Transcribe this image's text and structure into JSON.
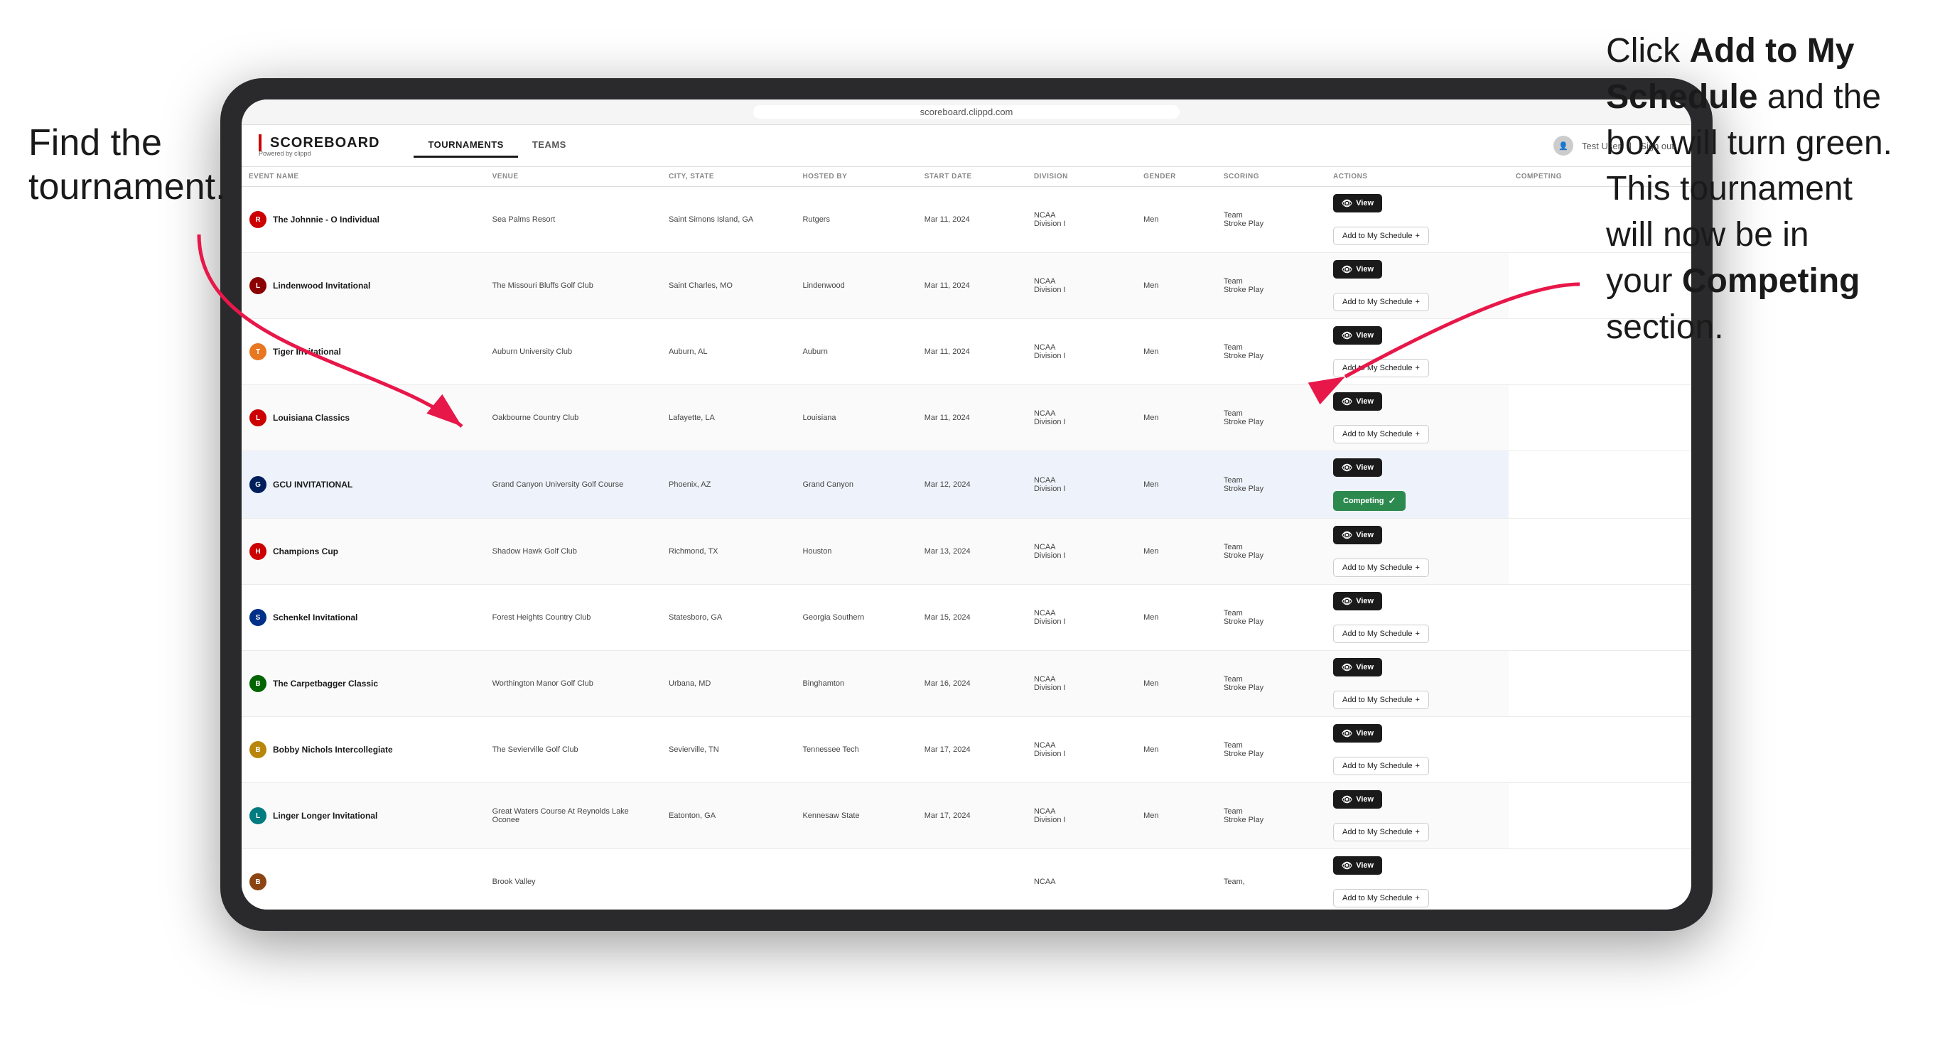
{
  "annotations": {
    "left_text_line1": "Find the",
    "left_text_line2": "tournament.",
    "right_text": "Click Add to My Schedule and the box will turn green. This tournament will now be in your Competing section.",
    "right_text_bold1": "Add to My Schedule",
    "right_text_bold2": "Competing"
  },
  "app": {
    "logo": "SCOREBOARD",
    "logo_sub": "Powered by clippd",
    "nav_tabs": [
      "TOURNAMENTS",
      "TEAMS"
    ],
    "active_tab": "TOURNAMENTS",
    "user_label": "Test User",
    "sign_out": "Sign out"
  },
  "table": {
    "columns": [
      "EVENT NAME",
      "VENUE",
      "CITY, STATE",
      "HOSTED BY",
      "START DATE",
      "DIVISION",
      "GENDER",
      "SCORING",
      "ACTIONS",
      "COMPETING"
    ],
    "rows": [
      {
        "id": 1,
        "logo_color": "logo-red",
        "logo_letter": "R",
        "event_name": "The Johnnie - O Individual",
        "venue": "Sea Palms Resort",
        "city_state": "Saint Simons Island, GA",
        "hosted_by": "Rutgers",
        "start_date": "Mar 11, 2024",
        "division": "NCAA Division I",
        "gender": "Men",
        "scoring": "Team, Stroke Play",
        "action": "View",
        "competing_status": "add",
        "competing_label": "Add to My Schedule +"
      },
      {
        "id": 2,
        "logo_color": "logo-maroon",
        "logo_letter": "L",
        "event_name": "Lindenwood Invitational",
        "venue": "The Missouri Bluffs Golf Club",
        "city_state": "Saint Charles, MO",
        "hosted_by": "Lindenwood",
        "start_date": "Mar 11, 2024",
        "division": "NCAA Division I",
        "gender": "Men",
        "scoring": "Team, Stroke Play",
        "action": "View",
        "competing_status": "add",
        "competing_label": "Add to My Schedule +"
      },
      {
        "id": 3,
        "logo_color": "logo-orange",
        "logo_letter": "T",
        "event_name": "Tiger Invitational",
        "venue": "Auburn University Club",
        "city_state": "Auburn, AL",
        "hosted_by": "Auburn",
        "start_date": "Mar 11, 2024",
        "division": "NCAA Division I",
        "gender": "Men",
        "scoring": "Team, Stroke Play",
        "action": "View",
        "competing_status": "add",
        "competing_label": "Add to My Schedule +"
      },
      {
        "id": 4,
        "logo_color": "logo-red",
        "logo_letter": "L",
        "event_name": "Louisiana Classics",
        "venue": "Oakbourne Country Club",
        "city_state": "Lafayette, LA",
        "hosted_by": "Louisiana",
        "start_date": "Mar 11, 2024",
        "division": "NCAA Division I",
        "gender": "Men",
        "scoring": "Team, Stroke Play",
        "action": "View",
        "competing_status": "add",
        "competing_label": "Add to My Schedule +"
      },
      {
        "id": 5,
        "logo_color": "logo-navy",
        "logo_letter": "G",
        "event_name": "GCU INVITATIONAL",
        "venue": "Grand Canyon University Golf Course",
        "city_state": "Phoenix, AZ",
        "hosted_by": "Grand Canyon",
        "start_date": "Mar 12, 2024",
        "division": "NCAA Division I",
        "gender": "Men",
        "scoring": "Team, Stroke Play",
        "action": "View",
        "competing_status": "competing",
        "competing_label": "Competing ✓",
        "highlighted": true
      },
      {
        "id": 6,
        "logo_color": "logo-red",
        "logo_letter": "H",
        "event_name": "Champions Cup",
        "venue": "Shadow Hawk Golf Club",
        "city_state": "Richmond, TX",
        "hosted_by": "Houston",
        "start_date": "Mar 13, 2024",
        "division": "NCAA Division I",
        "gender": "Men",
        "scoring": "Team, Stroke Play",
        "action": "View",
        "competing_status": "add",
        "competing_label": "Add to My Schedule +"
      },
      {
        "id": 7,
        "logo_color": "logo-blue",
        "logo_letter": "S",
        "event_name": "Schenkel Invitational",
        "venue": "Forest Heights Country Club",
        "city_state": "Statesboro, GA",
        "hosted_by": "Georgia Southern",
        "start_date": "Mar 15, 2024",
        "division": "NCAA Division I",
        "gender": "Men",
        "scoring": "Team, Stroke Play",
        "action": "View",
        "competing_status": "add",
        "competing_label": "Add to My Schedule +"
      },
      {
        "id": 8,
        "logo_color": "logo-green",
        "logo_letter": "B",
        "event_name": "The Carpetbagger Classic",
        "venue": "Worthington Manor Golf Club",
        "city_state": "Urbana, MD",
        "hosted_by": "Binghamton",
        "start_date": "Mar 16, 2024",
        "division": "NCAA Division I",
        "gender": "Men",
        "scoring": "Team, Stroke Play",
        "action": "View",
        "competing_status": "add",
        "competing_label": "Add to My Schedule +"
      },
      {
        "id": 9,
        "logo_color": "logo-gold",
        "logo_letter": "B",
        "event_name": "Bobby Nichols Intercollegiate",
        "venue": "The Sevierville Golf Club",
        "city_state": "Sevierville, TN",
        "hosted_by": "Tennessee Tech",
        "start_date": "Mar 17, 2024",
        "division": "NCAA Division I",
        "gender": "Men",
        "scoring": "Team, Stroke Play",
        "action": "View",
        "competing_status": "add",
        "competing_label": "Add to My Schedule +"
      },
      {
        "id": 10,
        "logo_color": "logo-teal",
        "logo_letter": "L",
        "event_name": "Linger Longer Invitational",
        "venue": "Great Waters Course At Reynolds Lake Oconee",
        "city_state": "Eatonton, GA",
        "hosted_by": "Kennesaw State",
        "start_date": "Mar 17, 2024",
        "division": "NCAA Division I",
        "gender": "Men",
        "scoring": "Team, Stroke Play",
        "action": "View",
        "competing_status": "add",
        "competing_label": "Add to My Schedule +"
      },
      {
        "id": 11,
        "logo_color": "logo-brown",
        "logo_letter": "B",
        "event_name": "",
        "venue": "Brook Valley",
        "city_state": "",
        "hosted_by": "",
        "start_date": "",
        "division": "NCAA",
        "gender": "",
        "scoring": "Team,",
        "action": "View",
        "competing_status": "add",
        "competing_label": "Add to My Schedule +"
      }
    ]
  }
}
